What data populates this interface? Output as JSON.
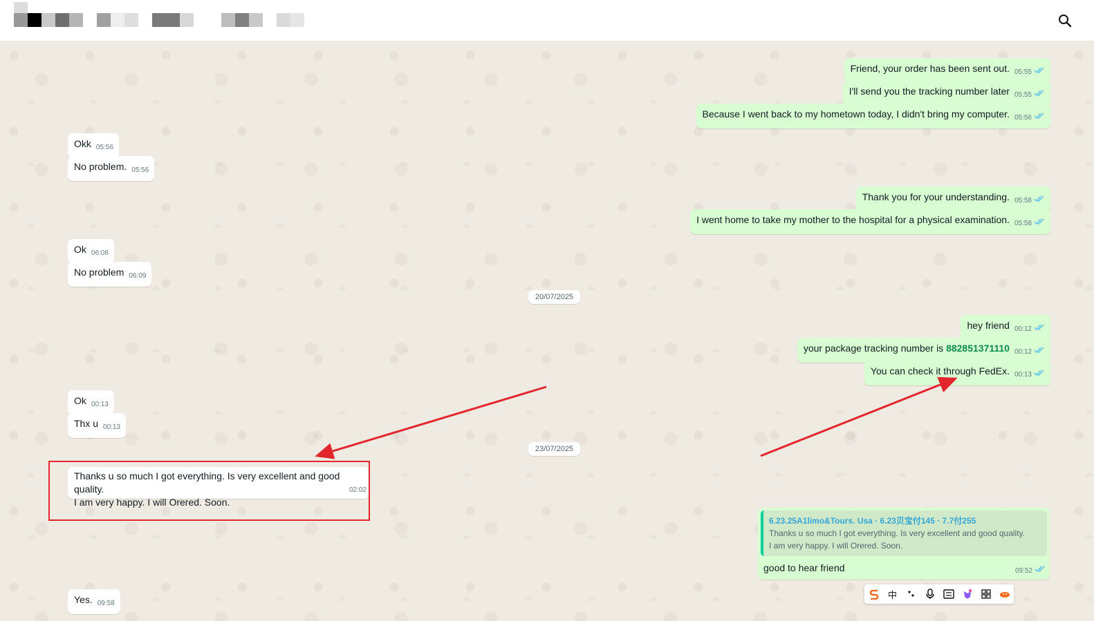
{
  "header": {
    "search_icon": "search-icon"
  },
  "messages": {
    "m1": {
      "text": "Friend, your order has been sent out.",
      "time": "05:55"
    },
    "m2": {
      "text": "I'll send you the tracking number later",
      "time": "05:55"
    },
    "m3": {
      "text": "Because I went back to my hometown today, I didn't bring my computer.",
      "time": "05:56"
    },
    "m4": {
      "text": "Okk",
      "time": "05:56"
    },
    "m5": {
      "text": "No problem.",
      "time": "05:56"
    },
    "m6": {
      "text": "Thank you for your understanding.",
      "time": "05:58"
    },
    "m7": {
      "text": "I went home to take my mother to the hospital for a physical examination.",
      "time": "05:58"
    },
    "m8": {
      "text": "Ok",
      "time": "06:08"
    },
    "m9": {
      "text": "No problem",
      "time": "06:09"
    },
    "m10": {
      "text": "hey friend",
      "time": "00:12"
    },
    "m11": {
      "prefix": "your package tracking number is ",
      "tracking": "882851371110",
      "time": "00:12"
    },
    "m12": {
      "text": "You can check it through FedEx.",
      "time": "00:13"
    },
    "m13": {
      "text": "Ok",
      "time": "00:13"
    },
    "m14": {
      "text": "Thx u",
      "time": "00:13"
    },
    "m15": {
      "line1": "Thanks u so much I got everything. Is very excellent and good quality.",
      "line2": "I am very happy.  I will Orered. Soon.",
      "time": "02:02"
    },
    "m16": {
      "quote_author": "6.23.25A1limo&Tours. Usa · 6.23贝宝付145 · 7.7付255",
      "quote_line1": "Thanks u so much I got everything. Is very excellent and good quality.",
      "quote_line2": "I am very happy.  I will Orered. Soon.",
      "text": "good to hear friend",
      "time": "09:52"
    },
    "m17": {
      "text": "Yes.",
      "time": "09:58"
    }
  },
  "dates": {
    "d1": "20/07/2025",
    "d2": "23/07/2025"
  },
  "ime_toolbar": {
    "chinese_mode": "中"
  },
  "colors": {
    "outgoing_bubble": "#d9fdd3",
    "incoming_bubble": "#ffffff",
    "annotation": "#e3262e",
    "read_tick": "#53bdeb"
  }
}
